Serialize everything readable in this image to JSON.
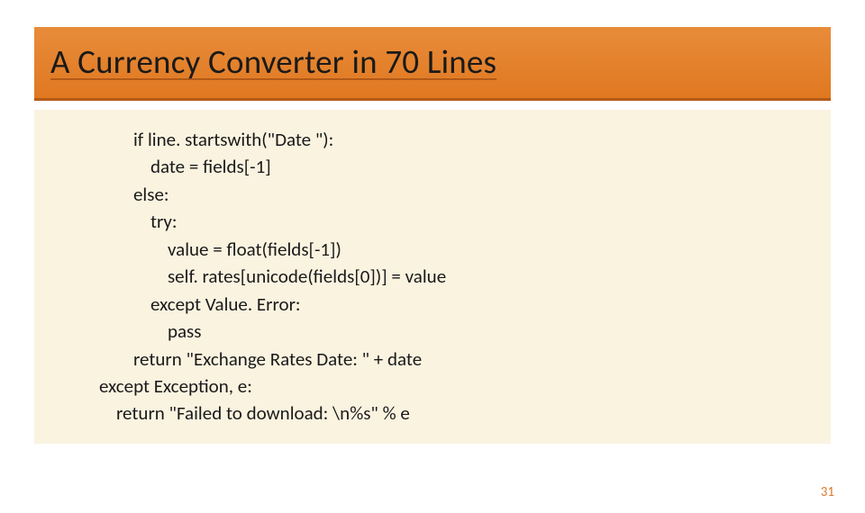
{
  "title": "A Currency Converter in 70 Lines",
  "code": {
    "l1": "        if line. startswith(\"Date \"):",
    "l2": "            date = fields[-1]",
    "l3": "        else:",
    "l4": "            try:",
    "l5": "                value = float(fields[-1])",
    "l6": "                self. rates[unicode(fields[0])] = value",
    "l7": "            except Value. Error:",
    "l8": "                pass",
    "l9": "        return \"Exchange Rates Date: \" + date",
    "l10": "except Exception, e:",
    "l11": "    return \"Failed to download: \\n%s\" % e"
  },
  "page_number": "31"
}
